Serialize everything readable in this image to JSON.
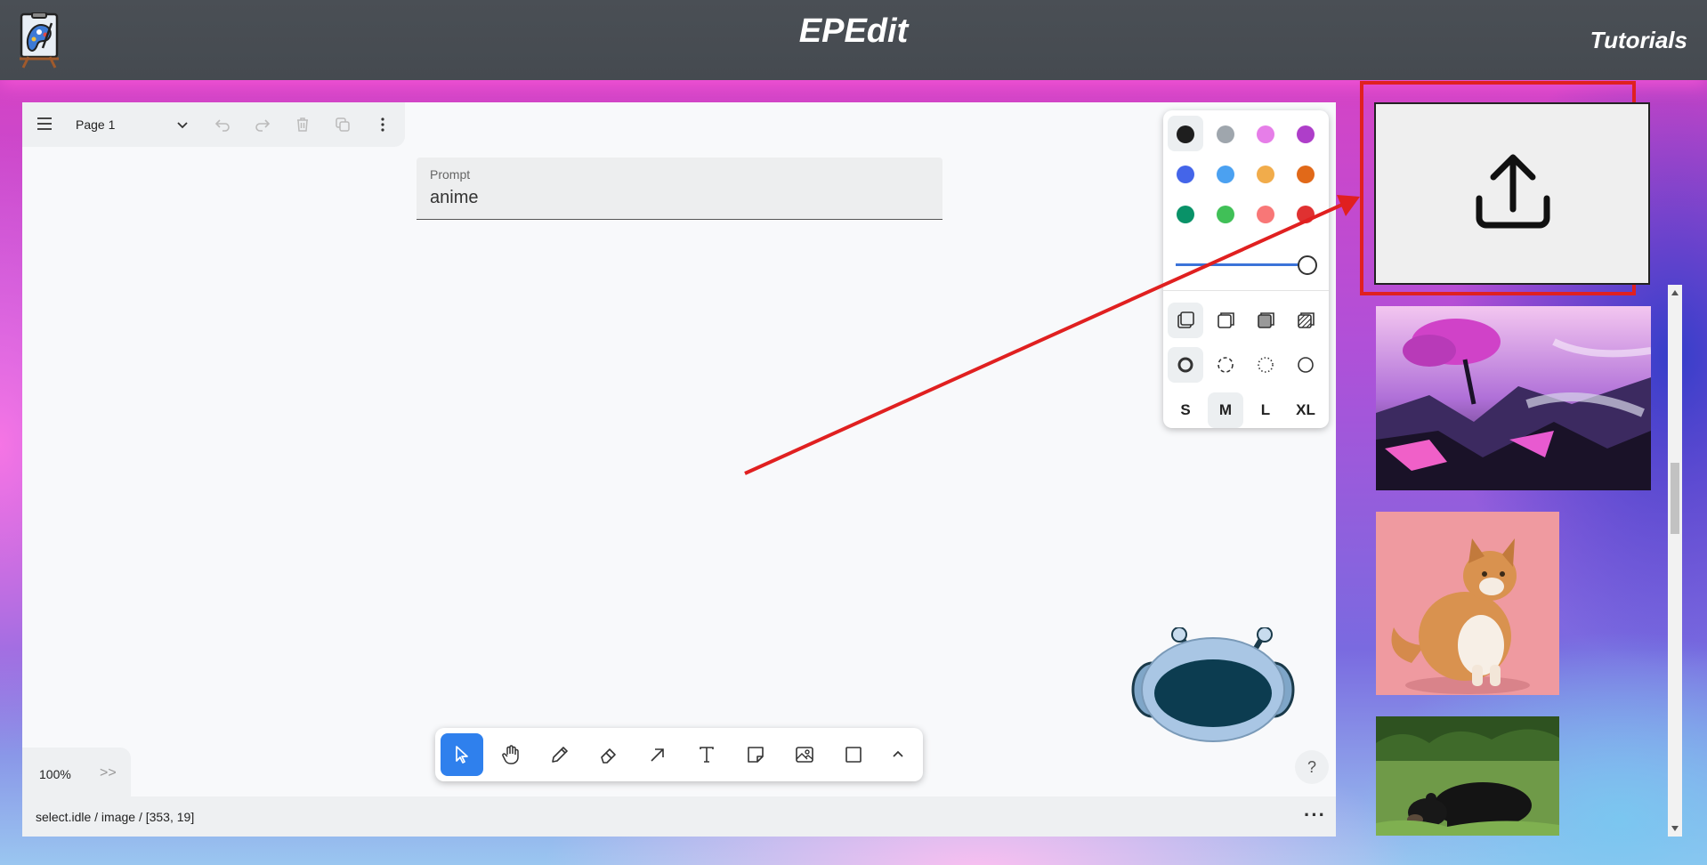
{
  "header": {
    "title": "EPEdit",
    "tutorials_label": "Tutorials"
  },
  "page_menu": {
    "page_name": "Page 1"
  },
  "prompt": {
    "label": "Prompt",
    "value": "anime"
  },
  "style_panel": {
    "colors": [
      "#1e1e1e",
      "#9fa6ad",
      "#e67ee8",
      "#ae3ec9",
      "#4465e9",
      "#4ba1f1",
      "#f1ac4b",
      "#e16919",
      "#099268",
      "#40c057",
      "#f87777",
      "#e03131"
    ],
    "selected_color": "#1e1e1e",
    "opacity_label": "opacity",
    "sizes": [
      "S",
      "M",
      "L",
      "XL"
    ],
    "selected_size": "M"
  },
  "toolbar": {
    "tools": [
      "select",
      "hand",
      "draw",
      "eraser",
      "arrow",
      "text",
      "note",
      "asset",
      "rectangle",
      "more"
    ],
    "active_tool": "select"
  },
  "zoom": {
    "value": "100%",
    "expand_label": ">>"
  },
  "help": {
    "label": "?"
  },
  "status": {
    "text": "select.idle / image / [353, 19]",
    "more_label": "···"
  },
  "gallery": {
    "upload_icon": "upload-icon",
    "images": [
      "fantasy-landscape",
      "orange-cat",
      "black-bear"
    ]
  },
  "colors": {
    "topbar": "#484d53",
    "accent": "#2f80ed",
    "highlight": "#e02020"
  }
}
